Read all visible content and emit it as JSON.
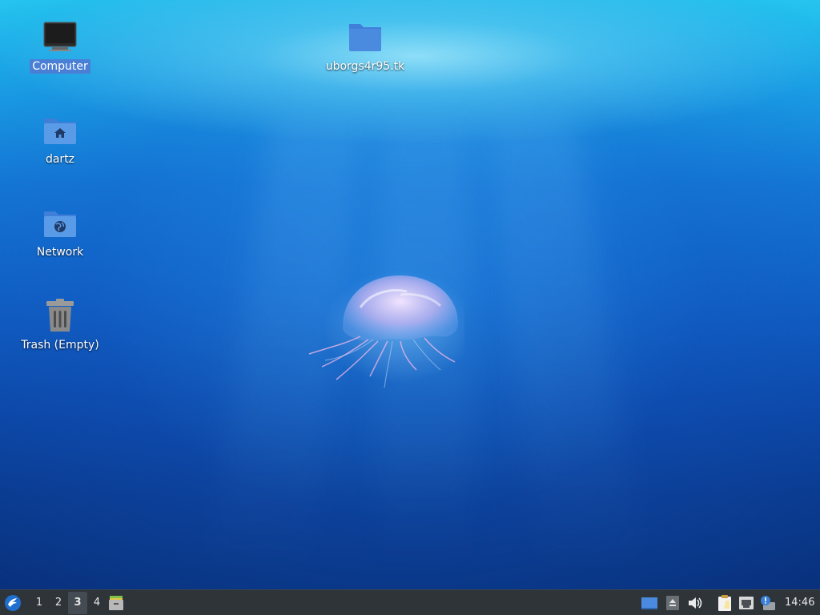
{
  "desktop": {
    "icons": {
      "computer": {
        "label": "Computer",
        "icon": "monitor-icon",
        "selected": true
      },
      "home": {
        "label": "dartz",
        "icon": "home-folder-icon"
      },
      "network": {
        "label": "Network",
        "icon": "network-folder-icon"
      },
      "trash": {
        "label": "Trash (Empty)",
        "icon": "trash-icon"
      },
      "folder": {
        "label": "uborgs4r95.tk",
        "icon": "folder-icon"
      }
    },
    "colors": {
      "selection": "#4a7fd6",
      "folder": "#4a8be0"
    }
  },
  "taskbar": {
    "start_icon": "lubuntu-menu-icon",
    "workspaces": [
      "1",
      "2",
      "3",
      "4"
    ],
    "active_workspace": "3",
    "launcher_icon": "file-manager-icon",
    "tray_icons": [
      "show-desktop-icon",
      "eject-icon",
      "volume-icon",
      "clipboard-icon",
      "network-icon",
      "update-notifier-icon"
    ],
    "clock": "14:46",
    "background": "#2f3439"
  }
}
